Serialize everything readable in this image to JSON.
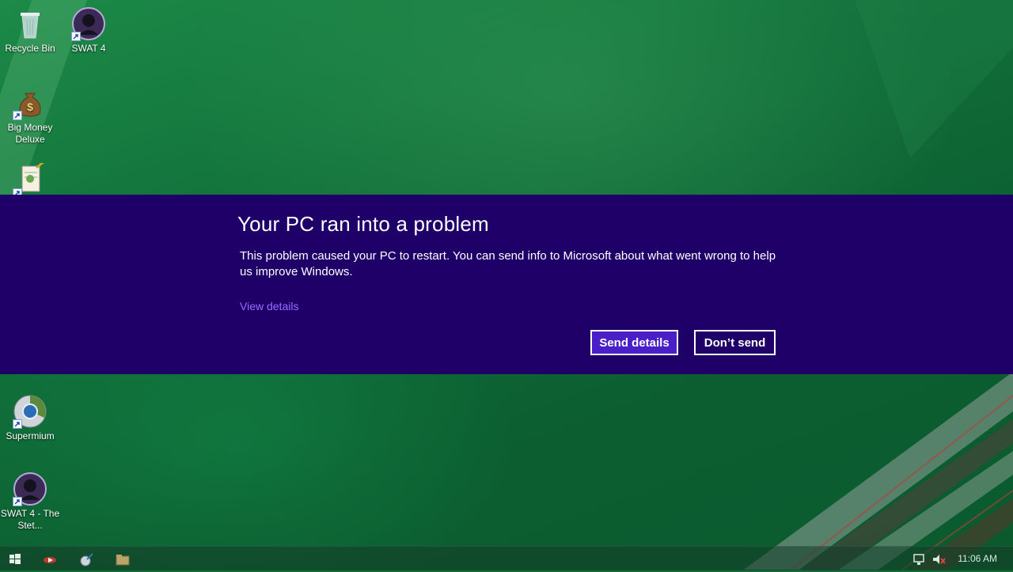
{
  "desktop": {
    "icons": [
      {
        "label": "Recycle Bin",
        "icon": "recycle-bin-icon"
      },
      {
        "label": "SWAT 4",
        "icon": "swat-game-icon"
      },
      {
        "label": "Big Money Deluxe",
        "icon": "money-bag-icon"
      },
      {
        "label": "",
        "icon": "notepad-app-icon"
      },
      {
        "label": "Supermium",
        "icon": "supermium-browser-icon"
      },
      {
        "label": "SWAT 4 - The Stet...",
        "icon": "swat-game-icon"
      }
    ]
  },
  "dialog": {
    "title": "Your PC ran into a problem",
    "message": "This problem caused your PC to restart. You can send info to Microsoft about what went wrong to help us improve Windows.",
    "view_details": "View details",
    "send_button": "Send details",
    "dont_send_button": "Don’t send",
    "colors": {
      "background": "#1e0068",
      "accent_button": "#4a1fc8",
      "link": "#9a6cff"
    }
  },
  "taskbar": {
    "items": [
      "start-icon",
      "media-player-icon",
      "paint-icon",
      "file-explorer-icon"
    ],
    "tray_icons": [
      "network-icon",
      "volume-muted-icon"
    ],
    "clock": "11:06 AM"
  }
}
